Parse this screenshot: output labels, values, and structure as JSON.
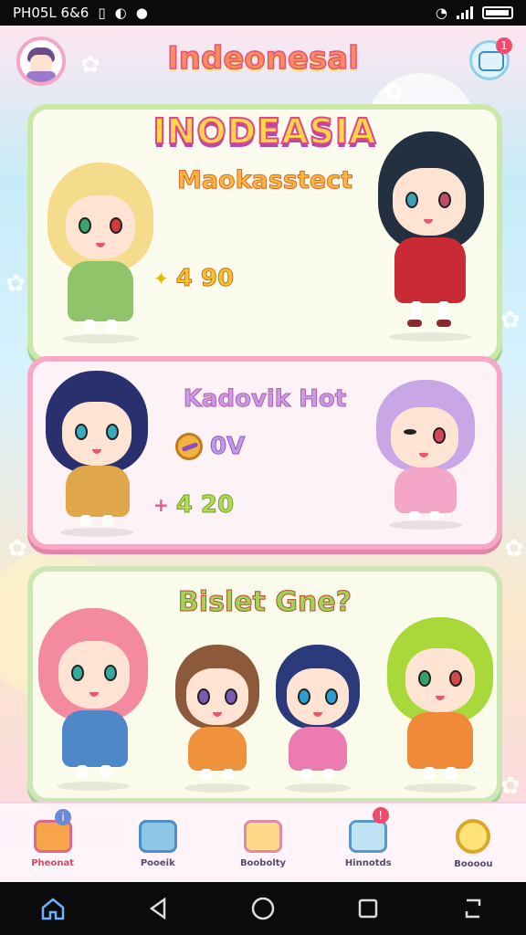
{
  "status_bar": {
    "time_text": "PH05L 6&6",
    "battery": "full"
  },
  "header": {
    "title": "Indeonesal",
    "chat_badge": "1"
  },
  "cards": [
    {
      "title": "INODEASIA",
      "subtitle": "Maokasstect",
      "stat_value": "4 90"
    },
    {
      "subtitle": "Kadovik Hot",
      "coin_value": "0V",
      "stat_value": "4 20"
    },
    {
      "subtitle": "Bislet Gne?"
    }
  ],
  "tabs": [
    {
      "label": "Pheonat",
      "icon": "house-icon",
      "active": true
    },
    {
      "label": "Pooeik",
      "icon": "star-house-icon",
      "active": false
    },
    {
      "label": "Boobolty",
      "icon": "gift-box-icon",
      "active": false
    },
    {
      "label": "Hinnotds",
      "icon": "puzzle-box-icon",
      "active": false
    },
    {
      "label": "Boooou",
      "icon": "search-icon",
      "active": false
    }
  ],
  "colors": {
    "accent_pink": "#f6a8c6",
    "accent_green": "#cbe8a8",
    "title_orange": "#ff8c5a",
    "badge_red": "#f04b6a"
  }
}
